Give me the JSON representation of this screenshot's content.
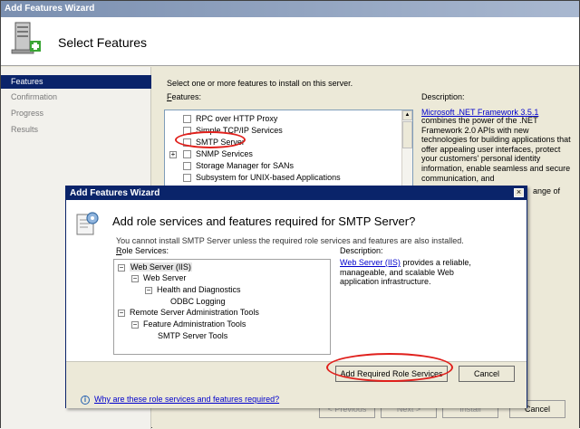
{
  "outer": {
    "title": "Add Features Wizard",
    "heading": "Select Features",
    "nav": [
      "Features",
      "Confirmation",
      "Progress",
      "Results"
    ],
    "instruction": "Select one or more features to install on this server.",
    "features_label_prefix": "F",
    "features_label_rest": "eatures:",
    "features": [
      "RPC over HTTP Proxy",
      "Simple TCP/IP Services",
      "SMTP Server",
      "SNMP Services",
      "Storage Manager for SANs",
      "Subsystem for UNIX-based Applications"
    ],
    "description_label": "Description:",
    "description_link": "Microsoft .NET Framework 3.5.1",
    "description_text": "combines the power of the .NET Framework 2.0 APIs with new technologies for building applications that offer appealing user interfaces, protect your customers' personal identity information, enable seamless and secure communication, and",
    "description_overflow": "ange of",
    "buttons": {
      "previous": "< Previous",
      "next": "Next >",
      "install": "Install",
      "cancel": "Cancel"
    }
  },
  "dialog": {
    "title": "Add Features Wizard",
    "close": "×",
    "heading": "Add role services and features required for SMTP Server?",
    "intro": "You cannot install SMTP Server unless the required role services and features are also installed.",
    "role_services_label_prefix": "R",
    "role_services_label_rest": "ole Services:",
    "description_label": "Description:",
    "tree": [
      {
        "label": "Web Server (IIS)",
        "depth": 0,
        "toggle": "−",
        "highlight": true
      },
      {
        "label": "Web Server",
        "depth": 1,
        "toggle": "−"
      },
      {
        "label": "Health and Diagnostics",
        "depth": 2,
        "toggle": "−"
      },
      {
        "label": "ODBC Logging",
        "depth": 3,
        "toggle": ""
      },
      {
        "label": "Remote Server Administration Tools",
        "depth": 0,
        "toggle": "−"
      },
      {
        "label": "Feature Administration Tools",
        "depth": 1,
        "toggle": "−"
      },
      {
        "label": "SMTP Server Tools",
        "depth": 2,
        "toggle": ""
      }
    ],
    "description_link": "Web Server (IIS)",
    "description_text": " provides a reliable, manageable, and scalable Web application infrastructure.",
    "buttons": {
      "add_required": "Add Required Role Services",
      "cancel": "Cancel"
    },
    "help_link": "Why are these role services and features required?"
  },
  "colors": {
    "annotation": "#e0201c",
    "link": "#0000cc",
    "selection": "#0a246a"
  }
}
